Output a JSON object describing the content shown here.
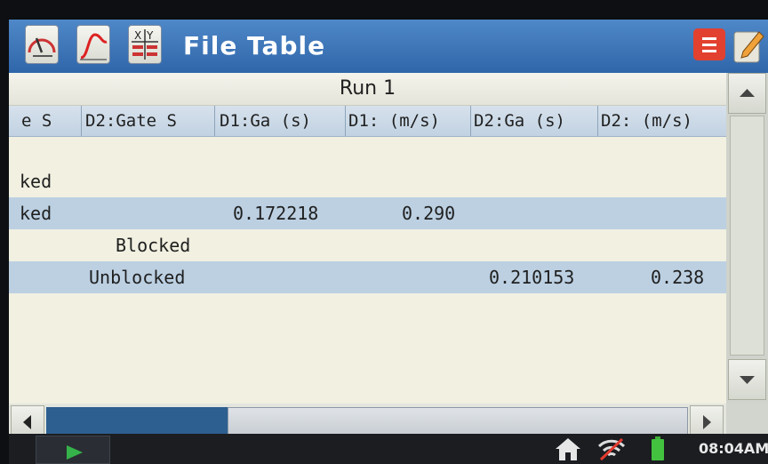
{
  "titlebar": {
    "title": "File Table",
    "icons": [
      "gauge-icon",
      "graph-icon",
      "table-icon",
      "menu-icon",
      "notebook-icon"
    ]
  },
  "table": {
    "run_label": "Run 1",
    "columns": [
      "e S",
      "D2:Gate S",
      "D1:Ga (s)",
      "D1: (m/s)",
      "D2:Ga (s)",
      "D2: (m/s)"
    ],
    "rows": [
      {
        "c0": "ked",
        "c1": "",
        "c2": "",
        "c3": "",
        "c4": "",
        "c5": ""
      },
      {
        "c0": "ked",
        "c1": "",
        "c2": "0.172218",
        "c3": "0.290",
        "c4": "",
        "c5": ""
      },
      {
        "c0": "",
        "c1": "Blocked",
        "c2": "",
        "c3": "",
        "c4": "",
        "c5": ""
      },
      {
        "c0": "",
        "c1": "Unblocked",
        "c2": "",
        "c3": "",
        "c4": "0.210153",
        "c5": "0.238"
      }
    ]
  },
  "status": {
    "time": "08:04AM",
    "icons": [
      "home-icon",
      "wifi-off-icon",
      "battery-icon"
    ]
  },
  "colors": {
    "titlebar": "#3a75b8",
    "row_alt": "#bcd0e2",
    "menu_button": "#e2412f",
    "battery": "#43c23f"
  }
}
